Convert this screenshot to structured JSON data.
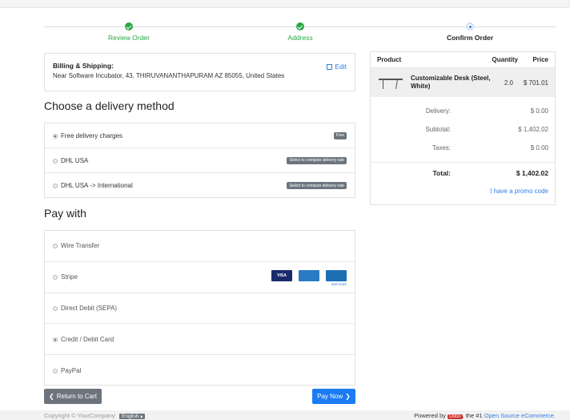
{
  "wizard": {
    "steps": [
      {
        "label": "Review Order",
        "state": "done"
      },
      {
        "label": "Address",
        "state": "done"
      },
      {
        "label": "Confirm Order",
        "state": "current"
      }
    ]
  },
  "billing": {
    "title": "Billing & Shipping:",
    "address": "Near Software Incubator, 43, THIRUVANANTHAPURAM AZ 85055, United States",
    "edit_label": "Edit"
  },
  "delivery": {
    "heading": "Choose a delivery method",
    "options": [
      {
        "label": "Free delivery charges",
        "badge": "Free",
        "selected": true
      },
      {
        "label": "DHL USA",
        "badge": "Select to compute delivery rate",
        "selected": false
      },
      {
        "label": "DHL USA -> International",
        "badge": "Select to compute delivery rate",
        "selected": false
      }
    ]
  },
  "payment": {
    "heading": "Pay with",
    "options": [
      {
        "label": "Wire Transfer",
        "selected": false
      },
      {
        "label": "Stripe",
        "selected": false
      },
      {
        "label": "Direct Debit (SEPA)",
        "selected": false
      },
      {
        "label": "Credit / Debit Card",
        "selected": true
      },
      {
        "label": "PayPal",
        "selected": false
      }
    ],
    "card_logos": [
      "VISA",
      "AMEX",
      "Diners"
    ],
    "and_more": "and more"
  },
  "buttons": {
    "return_label": "Return to Cart",
    "pay_label": "Pay Now"
  },
  "summary": {
    "headers": {
      "product": "Product",
      "quantity": "Quantity",
      "price": "Price"
    },
    "product": {
      "name": "Customizable Desk (Steel, White)",
      "quantity": "2.0",
      "price": "$ 701.01"
    },
    "delivery_label": "Delivery:",
    "delivery_value": "$ 0.00",
    "subtotal_label": "Subtotal:",
    "subtotal_value": "$ 1,402.02",
    "taxes_label": "Taxes:",
    "taxes_value": "$ 0.00",
    "total_label": "Total:",
    "total_value": "$ 1,402.02",
    "promo": "I have a promo code"
  },
  "footer": {
    "copyright": "Copyright © YourCompany",
    "language": "English",
    "powered_prefix": "Powered by",
    "odoo": "Odoo",
    "powered_mid": ", the #1",
    "powered_link": "Open Source eCommerce."
  },
  "colors": {
    "accent": "#2f7de1",
    "success": "#28a745",
    "button_primary": "#1a7bf2",
    "button_secondary": "#6c757d"
  }
}
